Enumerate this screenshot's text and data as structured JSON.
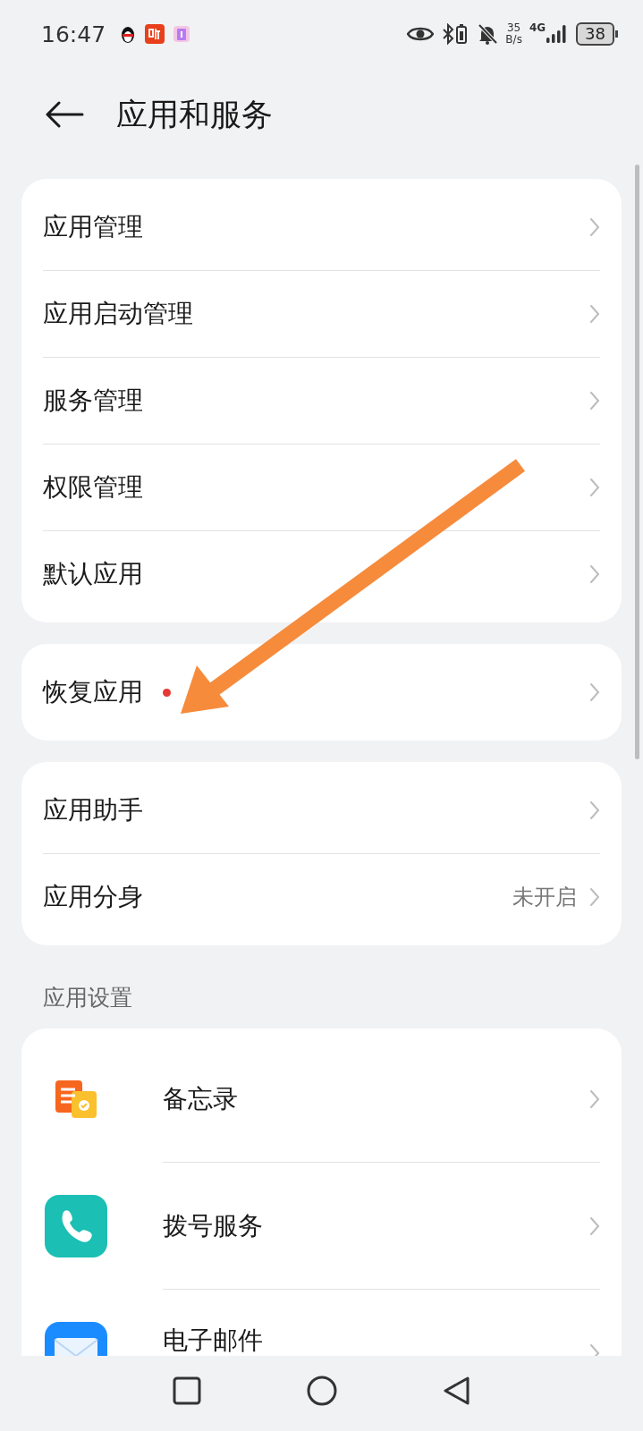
{
  "status_bar": {
    "time": "16:47",
    "net_speed": "35",
    "net_unit": "B/s",
    "network": "4G",
    "battery": "38"
  },
  "header": {
    "title": "应用和服务"
  },
  "groups": [
    {
      "items": [
        {
          "label": "应用管理",
          "badge": false
        },
        {
          "label": "应用启动管理",
          "badge": false
        },
        {
          "label": "服务管理",
          "badge": false
        },
        {
          "label": "权限管理",
          "badge": false
        },
        {
          "label": "默认应用",
          "badge": false
        }
      ]
    },
    {
      "items": [
        {
          "label": "恢复应用",
          "badge": true
        }
      ]
    },
    {
      "items": [
        {
          "label": "应用助手",
          "badge": false
        },
        {
          "label": "应用分身",
          "badge": false,
          "value": "未开启"
        }
      ]
    }
  ],
  "section": {
    "title": "应用设置",
    "apps": [
      {
        "label": "备忘录",
        "kind": "notes"
      },
      {
        "label": "拨号服务",
        "kind": "phone"
      },
      {
        "label": "电子邮件",
        "kind": "mail"
      }
    ]
  }
}
